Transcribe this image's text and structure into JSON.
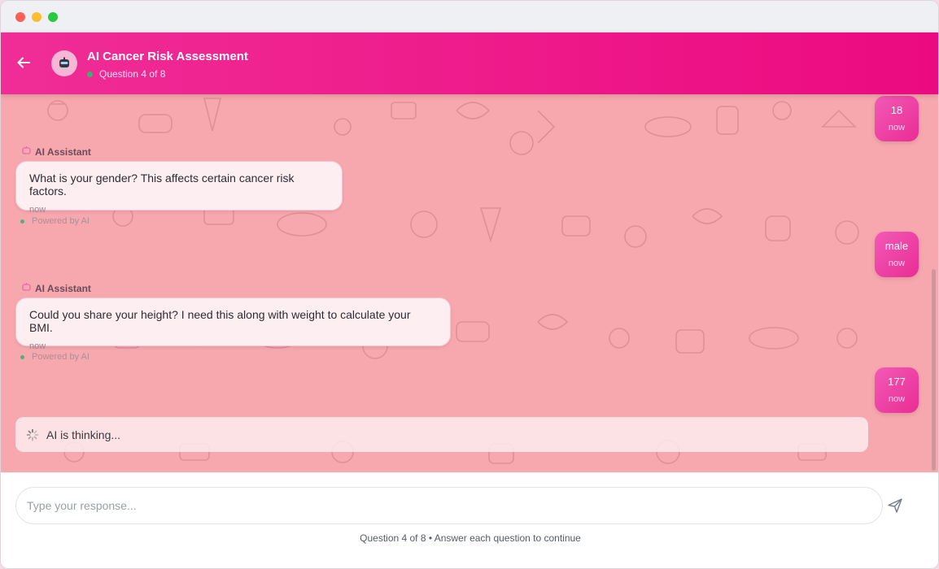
{
  "header": {
    "title": "AI Cancer Risk Assessment",
    "subtitle": "Question 4 of 8"
  },
  "messages": {
    "user": [
      {
        "value": "18",
        "time": "now"
      },
      {
        "value": "male",
        "time": "now"
      },
      {
        "value": "177",
        "time": "now"
      }
    ],
    "ai": [
      {
        "sender": "AI Assistant",
        "text": "What is your gender? This affects certain cancer risk factors.",
        "time": "now",
        "powered": "Powered by AI"
      },
      {
        "sender": "AI Assistant",
        "text": "Could you share your height? I need this along with weight to calculate your BMI.",
        "time": "now",
        "powered": "Powered by AI"
      }
    ]
  },
  "thinking": "AI is thinking...",
  "input": {
    "placeholder": "Type your response...",
    "value": ""
  },
  "footer": "Question 4 of 8 • Answer each question to continue",
  "colors": {
    "header_start": "#f02d97",
    "header_end": "#ec0a80",
    "chat_background": "#f7a8ae",
    "user_bubble": "#ea2c95",
    "status_online": "#2fb86b"
  }
}
